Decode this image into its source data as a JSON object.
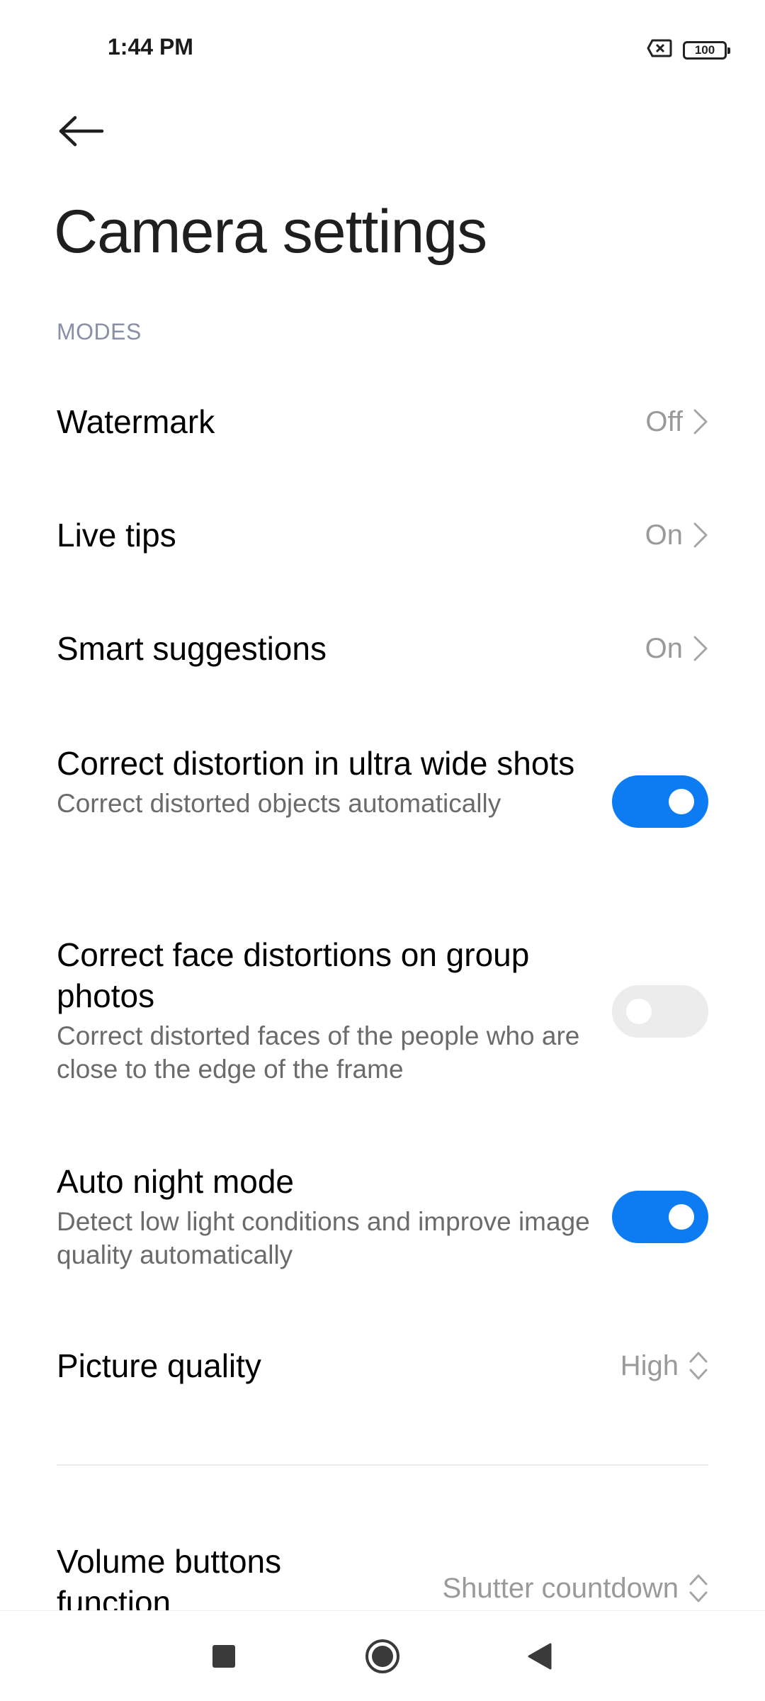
{
  "status_bar": {
    "time": "1:44 PM",
    "battery": "100"
  },
  "page": {
    "title": "Camera settings"
  },
  "sections": {
    "modes_header": "MODES"
  },
  "settings": {
    "watermark": {
      "title": "Watermark",
      "value": "Off"
    },
    "live_tips": {
      "title": "Live tips",
      "value": "On"
    },
    "smart_suggestions": {
      "title": "Smart suggestions",
      "value": "On"
    },
    "correct_ultra_wide": {
      "title": "Correct distortion in ultra wide shots",
      "subtitle": "Correct distorted objects automatically",
      "enabled": true
    },
    "correct_face": {
      "title": "Correct face distortions on group photos",
      "subtitle": "Correct distorted faces of the people who are close to the edge of the frame",
      "enabled": false
    },
    "auto_night": {
      "title": "Auto night mode",
      "subtitle": "Detect low light conditions and improve image quality automatically",
      "enabled": true
    },
    "picture_quality": {
      "title": "Picture quality",
      "value": "High"
    },
    "volume_buttons": {
      "title": "Volume buttons function",
      "value": "Shutter countdown"
    }
  },
  "colors": {
    "accent": "#0d7cf2",
    "toggle_off": "#ececec",
    "secondary_text": "#9a9a9a",
    "section_header": "#8a8fa8"
  },
  "icons": {
    "back": "arrow-left-icon",
    "chevron": "chevron-right-icon",
    "spinner": "up-down-chevron-icon",
    "sim": "no-sim-icon",
    "battery": "battery-icon",
    "nav_recents": "square-icon",
    "nav_home": "circle-icon",
    "nav_back": "triangle-back-icon"
  }
}
